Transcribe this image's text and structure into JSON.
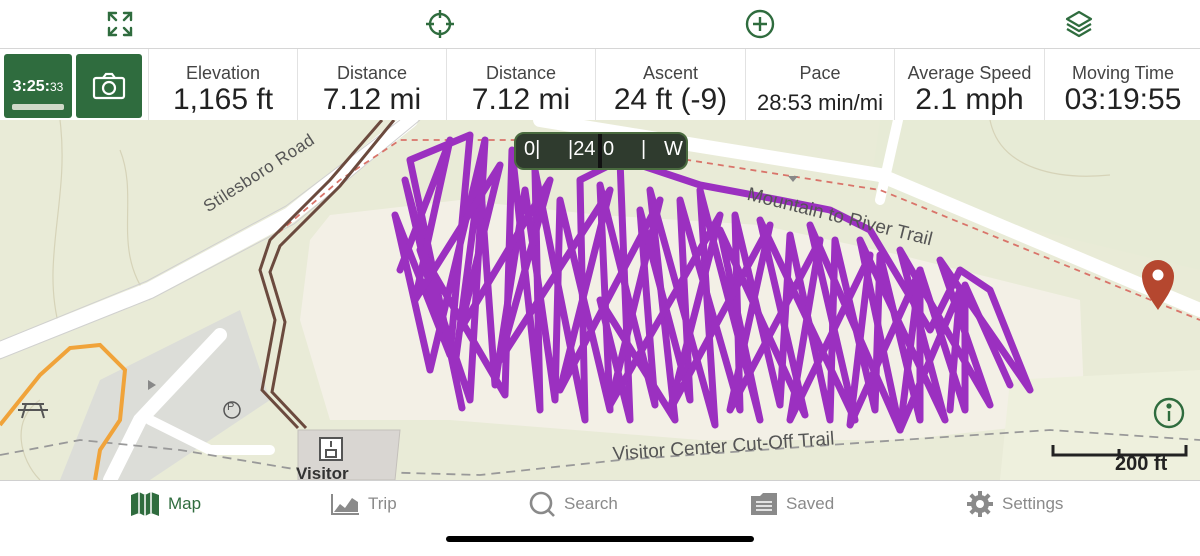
{
  "toolbar": {
    "icons": [
      "fullscreen-icon",
      "crosshair-icon",
      "add-circle-icon",
      "layers-icon"
    ]
  },
  "recorder": {
    "time_main": "3:25:",
    "time_small": "33"
  },
  "stats": [
    {
      "label": "Elevation",
      "value": "1,165 ft"
    },
    {
      "label": "Distance",
      "value": "7.12 mi"
    },
    {
      "label": "Distance",
      "value": "7.12 mi"
    },
    {
      "label": "Ascent",
      "value": "24 ft (-9)"
    },
    {
      "label": "Pace",
      "value": "28:53 min/mi"
    },
    {
      "label": "Average Speed",
      "value": "2.1 mph"
    },
    {
      "label": "Moving Time",
      "value": "03:19:55"
    }
  ],
  "map": {
    "labels": {
      "road": "Stilesboro Road",
      "trail1": "Mountain to River Trail",
      "trail2": "Visitor Center Cut-Off Trail",
      "building": "Visitor",
      "parking": "P"
    },
    "compass": {
      "ticks": [
        "0|",
        "|24",
        "0",
        "|",
        "W"
      ]
    },
    "scale": "200 ft",
    "colors": {
      "track": "#9b30c0",
      "marker": "#b5472f",
      "green": "#2f6c3e"
    }
  },
  "tabs": [
    {
      "label": "Map",
      "icon": "map-icon"
    },
    {
      "label": "Trip",
      "icon": "chart-icon"
    },
    {
      "label": "Search",
      "icon": "search-icon"
    },
    {
      "label": "Saved",
      "icon": "folder-icon"
    },
    {
      "label": "Settings",
      "icon": "gear-icon"
    }
  ]
}
